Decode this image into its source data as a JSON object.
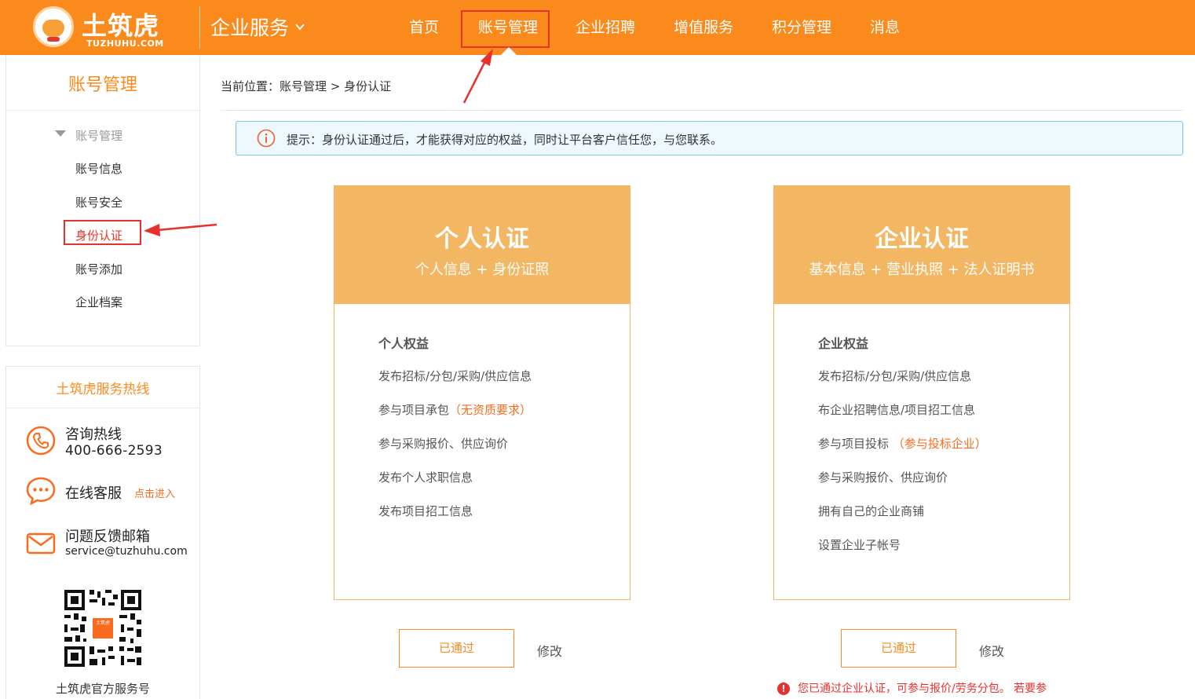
{
  "header": {
    "logo_text": "土筑虎",
    "logo_sub": "TUZHUHU.COM",
    "service_title": "企业服务",
    "nav": [
      {
        "label": "首页"
      },
      {
        "label": "账号管理"
      },
      {
        "label": "企业招聘"
      },
      {
        "label": "增值服务"
      },
      {
        "label": "积分管理"
      },
      {
        "label": "消息"
      }
    ],
    "active_nav": "账号管理",
    "accent_color": "#fb8a1d"
  },
  "sidebar": {
    "title": "账号管理",
    "group_label": "账号管理",
    "items": [
      {
        "label": "账号信息"
      },
      {
        "label": "账号安全"
      },
      {
        "label": "身份认证"
      },
      {
        "label": "账号添加"
      },
      {
        "label": "企业档案"
      }
    ],
    "active_item": "身份认证"
  },
  "hotline": {
    "title": "土筑虎服务热线",
    "consult_label": "咨询热线",
    "consult_number": "400-666-2593",
    "online_label": "在线客服",
    "online_link": "点击进入",
    "email_label": "问题反馈邮箱",
    "email_value": "service@tuzhuhu.com",
    "qr_caption": "土筑虎官方服务号",
    "qr_badge": "土筑虎"
  },
  "main": {
    "breadcrumb": "当前位置：账号管理 > 身份认证",
    "tip": "提示：身份认证通过后，才能获得对应的权益，同时让平台客户信任您，与您联系。",
    "personal": {
      "title": "个人认证",
      "subtitle": "个人信息 + 身份证照",
      "list_title": "个人权益",
      "items": [
        {
          "text": "发布招标/分包/采购/供应信息",
          "highlight": ""
        },
        {
          "text": "参与项目承包",
          "highlight": "（无资质要求）"
        },
        {
          "text": "参与采购报价、供应询价",
          "highlight": ""
        },
        {
          "text": "发布个人求职信息",
          "highlight": ""
        },
        {
          "text": "发布项目招工信息",
          "highlight": ""
        }
      ],
      "button": "已通过",
      "modify": "修改"
    },
    "enterprise": {
      "title": "企业认证",
      "subtitle": "基本信息 + 营业执照 + 法人证明书",
      "list_title": "企业权益",
      "items": [
        {
          "text": "发布招标/分包/采购/供应信息",
          "highlight": ""
        },
        {
          "text": "布企业招聘信息/项目招工信息",
          "highlight": ""
        },
        {
          "text": "参与项目投标",
          "highlight": " （参与投标企业）"
        },
        {
          "text": "参与采购报价、供应询价",
          "highlight": ""
        },
        {
          "text": "拥有自己的企业商铺",
          "highlight": ""
        },
        {
          "text": "设置企业子帐号",
          "highlight": ""
        }
      ],
      "button": "已通过",
      "modify": "修改",
      "notice": "您已通过企业认证，可参与报价/劳务分包。 若要参"
    }
  }
}
